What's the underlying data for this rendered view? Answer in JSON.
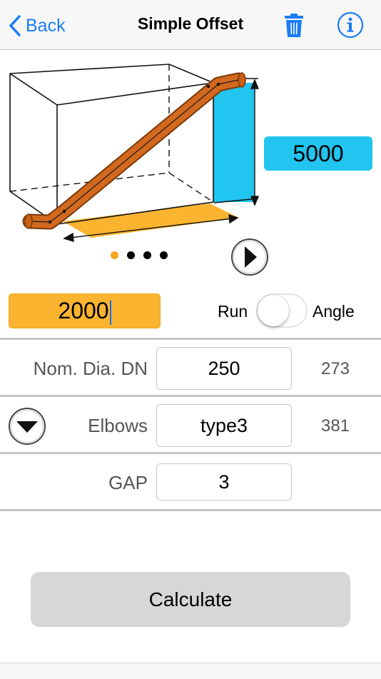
{
  "navbar": {
    "back_label": "Back",
    "title": "Simple Offset",
    "icons": [
      "chevron-left-icon",
      "trash-icon",
      "info-icon"
    ],
    "accent_color": "#1a7cf6"
  },
  "diagram": {
    "dimension_value": "5000",
    "pipe_color": "#d2691e",
    "run_highlight_color": "#fbb430",
    "rise_highlight_color": "#22c4f0",
    "page_indicator": {
      "count": 4,
      "active": 1
    }
  },
  "run_input": {
    "value": "2000"
  },
  "toggle": {
    "left_label": "Run",
    "right_label": "Angle",
    "on": false
  },
  "rows": {
    "diameter": {
      "label": "Nom. Dia. DN",
      "value": "250",
      "side_value": "273"
    },
    "elbows": {
      "label": "Elbows",
      "value": "type3",
      "side_value": "381"
    },
    "gap": {
      "label": "GAP",
      "value": "3"
    }
  },
  "calculate_label": "Calculate"
}
